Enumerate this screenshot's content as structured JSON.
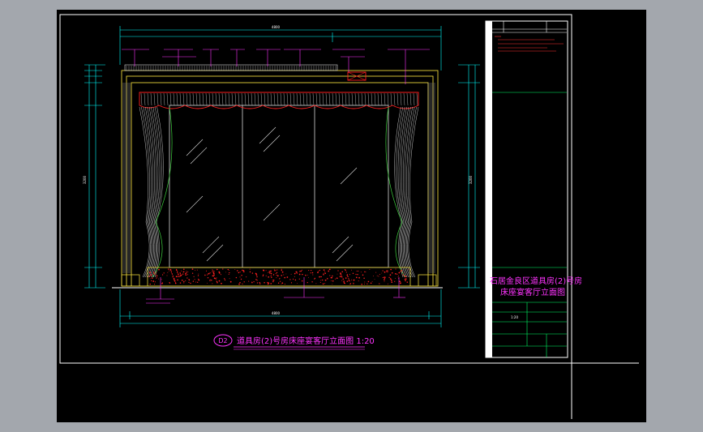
{
  "drawing": {
    "title_main": "道具房(2)号房床座宴客厅立面图 1:20",
    "title_badge": "D2",
    "side_title_line1": "石居金良区道具房(2)号房",
    "side_title_line2": "床座宴客厅立面图",
    "scale_cell": "1:20",
    "overall_width_dim": "4800",
    "overall_height_dim": "3200"
  },
  "colors": {
    "background": "#000000",
    "frame": "#ffffff",
    "dimension": "#00ffff",
    "label": "#ff33ff",
    "curtain": "#d9d9d9",
    "frame_yellow": "#e6d23a",
    "glass": "#3fd13f",
    "base_red": "#ff2020"
  }
}
